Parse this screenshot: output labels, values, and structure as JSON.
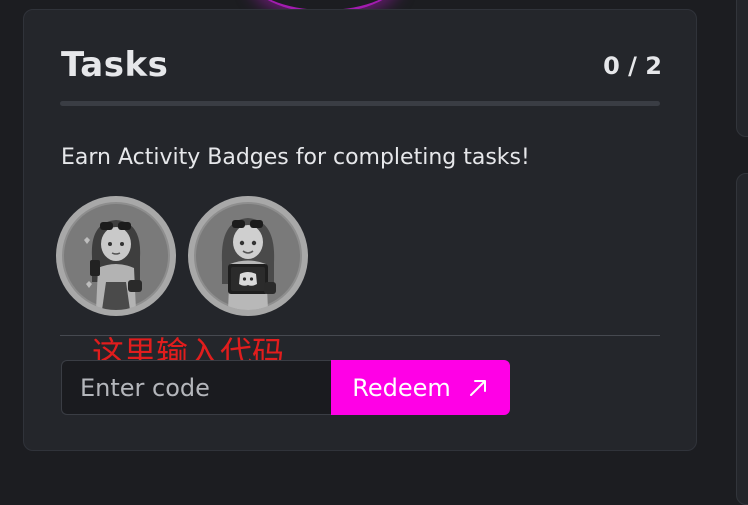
{
  "tasks": {
    "title": "Tasks",
    "progress": "0 / 2",
    "description": "Earn Activity Badges for completing tasks!",
    "badges": [
      {
        "icon": "girl-with-phone-badge-icon"
      },
      {
        "icon": "girl-with-discord-tablet-badge-icon"
      }
    ]
  },
  "annotation": "这里输入代码",
  "redeem": {
    "placeholder": "Enter code",
    "button_label": "Redeem",
    "button_icon": "arrow-up-right-icon"
  },
  "colors": {
    "accent": "#ff00e6",
    "card_bg": "#24262b",
    "page_bg": "#1c1d21",
    "annotation": "#e11d1d"
  }
}
